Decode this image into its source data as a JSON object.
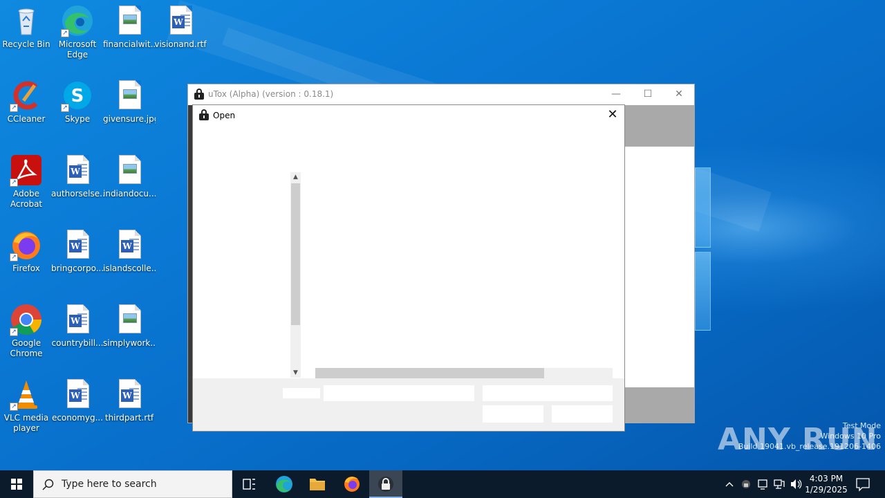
{
  "desktop": {
    "icons": [
      {
        "id": "recycle-bin",
        "label": "Recycle Bin"
      },
      {
        "id": "edge",
        "label": "Microsoft Edge"
      },
      {
        "id": "financialwit",
        "label": "financialwit..."
      },
      {
        "id": "visionand",
        "label": "visionand.rtf"
      },
      {
        "id": "ccleaner",
        "label": "CCleaner"
      },
      {
        "id": "skype",
        "label": "Skype"
      },
      {
        "id": "givensure",
        "label": "givensure.jpg"
      },
      {
        "id": "acrobat",
        "label": "Adobe Acrobat"
      },
      {
        "id": "authorselse",
        "label": "authorselse..."
      },
      {
        "id": "indiandocu",
        "label": "indiandocu..."
      },
      {
        "id": "firefox",
        "label": "Firefox"
      },
      {
        "id": "bringcorpo",
        "label": "bringcorpo..."
      },
      {
        "id": "islandscolle",
        "label": "islandscolle..."
      },
      {
        "id": "chrome",
        "label": "Google Chrome"
      },
      {
        "id": "countrybill",
        "label": "countrybill..."
      },
      {
        "id": "simplywork",
        "label": "simplywork..."
      },
      {
        "id": "vlc",
        "label": "VLC media player"
      },
      {
        "id": "economyg",
        "label": "economyg..."
      },
      {
        "id": "thirdpart",
        "label": "thirdpart.rtf"
      }
    ]
  },
  "utox_window": {
    "title": "uTox (Alpha) (version : 0.18.1)",
    "minimize": "—",
    "maximize": "☐",
    "close": "✕"
  },
  "open_dialog": {
    "title": "Open",
    "close": "✕",
    "scroll_up": "▲",
    "scroll_down": "▼"
  },
  "watermark": {
    "brand": "ANY RUN",
    "line1": "Test Mode",
    "line2": "Windows 10 Pro",
    "line3": "Build 19041.vb_release.191206-1406"
  },
  "taskbar": {
    "search_placeholder": "Type here to search",
    "time": "4:03 PM",
    "date": "1/29/2025"
  },
  "colors": {
    "desktop_blue": "#0a78d4",
    "taskbar": "#0c1b2c"
  }
}
